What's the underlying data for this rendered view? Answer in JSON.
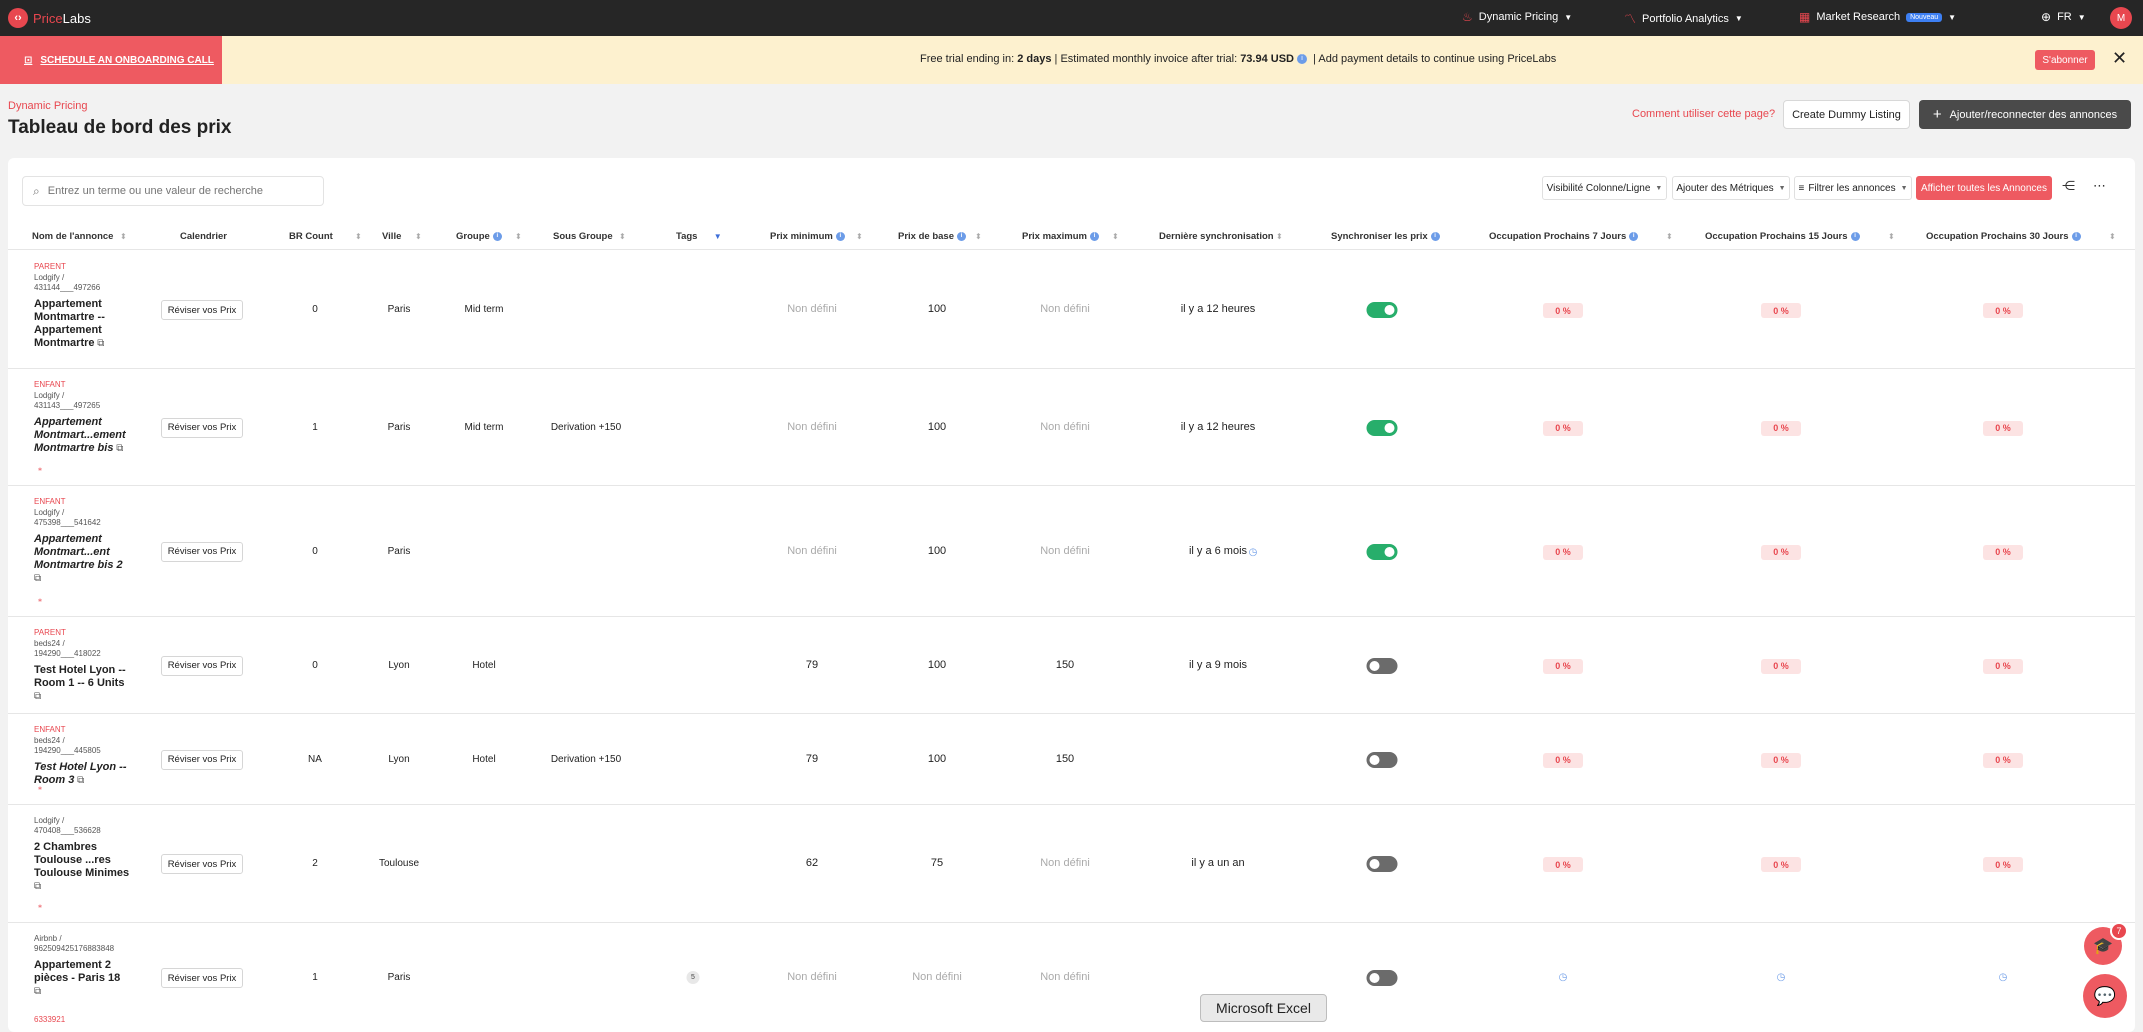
{
  "nav": {
    "brand_part1": "Price",
    "brand_part2": "Labs",
    "dynamic_pricing": "Dynamic Pricing",
    "portfolio_analytics": "Portfolio Analytics",
    "market_research": "Market Research",
    "new_badge": "Nouveau",
    "language": "FR",
    "avatar_initial": "M"
  },
  "banner": {
    "onboarding_call": "SCHEDULE AN ONBOARDING CALL",
    "trial_prefix": "Free trial ending in: ",
    "trial_days": "2 days",
    "trial_mid": " | Estimated monthly invoice after trial: ",
    "trial_amount": "73.94 USD",
    "trial_suffix": " | Add payment details to continue using PriceLabs",
    "subscribe": "S'abonner",
    "close": "✕"
  },
  "header": {
    "breadcrumb": "Dynamic Pricing",
    "title": "Tableau de bord des prix",
    "help_link": "Comment utiliser cette page?",
    "dummy_button": "Create Dummy Listing",
    "add_button": "Ajouter/reconnecter des annonces"
  },
  "toolbar": {
    "search_placeholder": "Entrez un terme ou une valeur de recherche",
    "visibility": "Visibilité Colonne/Ligne",
    "add_metrics": "Ajouter des Métriques",
    "filter": "Filtrer les annonces",
    "show_all": "Afficher toutes les Annonces"
  },
  "columns": {
    "name": "Nom de l'annonce",
    "calendar": "Calendrier",
    "br_count": "BR Count",
    "city": "Ville",
    "group": "Groupe",
    "subgroup": "Sous Groupe",
    "tags": "Tags",
    "min_price": "Prix minimum",
    "base_price": "Prix de base",
    "max_price": "Prix maximum",
    "last_sync": "Dernière synchronisation",
    "sync_prices": "Synchroniser les prix",
    "occ7": "Occupation Prochains 7 Jours",
    "occ15": "Occupation Prochains 15 Jours",
    "occ30": "Occupation Prochains 30 Jours"
  },
  "review_label": "Réviser vos Prix",
  "rows": [
    {
      "type": "PARENT",
      "source": "Lodgify / 431144___497266",
      "name": "Appartement Montmartre -- Appartement Montmartre",
      "br": "0",
      "city": "Paris",
      "group": "Mid term",
      "subgroup": "",
      "min": "Non défini",
      "base": "100",
      "max": "Non défini",
      "sync": "il y a 12 heures",
      "toggle": true,
      "occ7": "0 %",
      "occ15": "0 %",
      "occ30": "0 %"
    },
    {
      "type": "ENFANT",
      "source": "Lodgify / 431143___497265",
      "name": "Appartement Montmart...ement Montmartre bis",
      "br": "1",
      "city": "Paris",
      "group": "Mid term",
      "subgroup": "Derivation +150",
      "min": "Non défini",
      "base": "100",
      "max": "Non défini",
      "sync": "il y a 12 heures",
      "toggle": true,
      "occ7": "0 %",
      "occ15": "0 %",
      "occ30": "0 %"
    },
    {
      "type": "ENFANT",
      "source": "Lodgify / 475398___541642",
      "name": "Appartement Montmart...ent Montmartre bis 2",
      "br": "0",
      "city": "Paris",
      "group": "",
      "subgroup": "",
      "min": "Non défini",
      "base": "100",
      "max": "Non défini",
      "sync": "il y a 6 mois",
      "toggle": true,
      "occ7": "0 %",
      "occ15": "0 %",
      "occ30": "0 %"
    },
    {
      "type": "PARENT",
      "source": "beds24 / 194290___418022",
      "name": "Test Hotel Lyon -- Room 1 -- 6 Units",
      "br": "0",
      "city": "Lyon",
      "group": "Hotel",
      "subgroup": "",
      "min": "79",
      "base": "100",
      "max": "150",
      "sync": "il y a 9 mois",
      "toggle": false,
      "occ7": "0 %",
      "occ15": "0 %",
      "occ30": "0 %"
    },
    {
      "type": "ENFANT",
      "source": "beds24 / 194290___445805",
      "name": "Test Hotel Lyon -- Room 3",
      "br": "NA",
      "city": "Lyon",
      "group": "Hotel",
      "subgroup": "Derivation +150",
      "min": "79",
      "base": "100",
      "max": "150",
      "sync": "",
      "toggle": false,
      "occ7": "0 %",
      "occ15": "0 %",
      "occ30": "0 %"
    },
    {
      "type": "",
      "source": "Lodgify / 470408___536628",
      "name": "2 Chambres Toulouse ...res Toulouse Minimes",
      "br": "2",
      "city": "Toulouse",
      "group": "",
      "subgroup": "",
      "min": "62",
      "base": "75",
      "max": "Non défini",
      "sync": "il y a un an",
      "toggle": false,
      "occ7": "0 %",
      "occ15": "0 %",
      "occ30": "0 %"
    },
    {
      "type": "",
      "source": "Airbnb / 962509425176883848",
      "name": "Appartement 2 pièces - Paris 18",
      "extra": "6333921",
      "br": "1",
      "city": "Paris",
      "group": "",
      "subgroup": "",
      "tag_count": "5",
      "min": "Non défini",
      "base": "Non défini",
      "max": "Non défini",
      "sync": "",
      "toggle": false,
      "occ7": "",
      "occ15": "",
      "occ30": ""
    }
  ],
  "floating": {
    "tooltip": "Microsoft Excel",
    "notif_count": "7"
  },
  "colors": {
    "brand_red": "#e8474f",
    "toggle_on": "#27ae6b",
    "nav_bg": "#262626",
    "banner_bg": "#fdf1cf"
  }
}
